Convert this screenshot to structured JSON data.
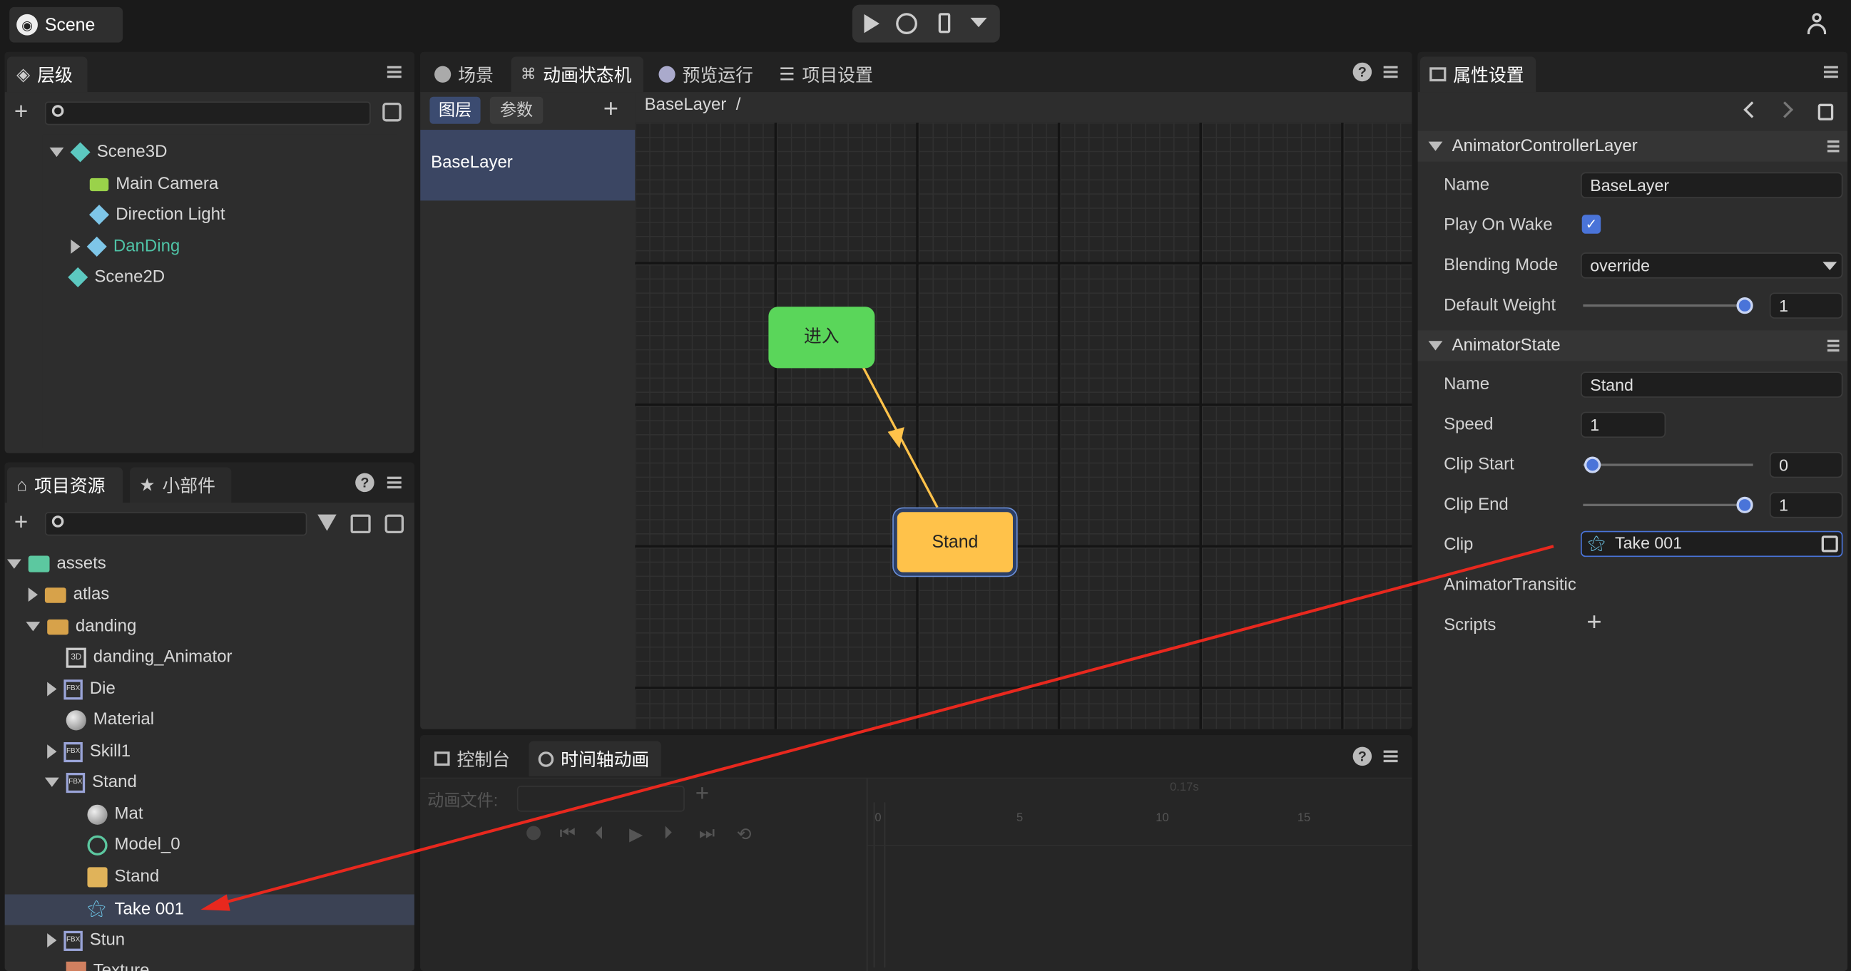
{
  "top": {
    "scene_tab": "Scene"
  },
  "hierarchy": {
    "title": "层级",
    "items": [
      {
        "label": "Scene3D",
        "color": "#d8d8d8"
      },
      {
        "label": "Main Camera",
        "color": "#d8d8d8"
      },
      {
        "label": "Direction Light",
        "color": "#d8d8d8"
      },
      {
        "label": "DanDing",
        "color": "#4fc3a6"
      },
      {
        "label": "Scene2D",
        "color": "#d8d8d8"
      }
    ]
  },
  "assets": {
    "tab1": "项目资源",
    "tab2": "小部件",
    "items": [
      "assets",
      "atlas",
      "danding",
      "danding_Animator",
      "Die",
      "Material",
      "Skill1",
      "Stand",
      "Mat",
      "Model_0",
      "Stand",
      "Take 001",
      "Stun",
      "Texture"
    ]
  },
  "center": {
    "tabs": [
      "场景",
      "动画状态机",
      "预览运行",
      "项目设置"
    ],
    "subtabs": [
      "图层",
      "参数"
    ],
    "breadcrumb": "BaseLayer  /",
    "layer_item": "BaseLayer",
    "nodes": {
      "entry": "进入",
      "stand": "Stand"
    },
    "colors": {
      "entry": "#5ad65a",
      "stand": "#ffc24a",
      "transition": "#ffc24a"
    }
  },
  "bottom": {
    "tabs": [
      "控制台",
      "时间轴动画"
    ],
    "anim_file_label": "动画文件:",
    "ruler": [
      "0",
      "5",
      "10",
      "15"
    ],
    "time": "0.17s"
  },
  "properties": {
    "title": "属性设置",
    "layer_section": "AnimatorControllerLayer",
    "layer": {
      "name_label": "Name",
      "name": "BaseLayer",
      "wake_label": "Play On Wake",
      "wake_checked": true,
      "blend_label": "Blending Mode",
      "blend": "override",
      "weight_label": "Default Weight",
      "weight": "1",
      "weight_fraction": 1.0
    },
    "state_section": "AnimatorState",
    "state": {
      "name_label": "Name",
      "name": "Stand",
      "speed_label": "Speed",
      "speed": "1",
      "clip_start_label": "Clip Start",
      "clip_start": "0",
      "clip_start_fraction": 0.0,
      "clip_end_label": "Clip End",
      "clip_end": "1",
      "clip_end_fraction": 1.0,
      "clip_label": "Clip",
      "clip": "Take 001",
      "transition_label": "AnimatorTransitic",
      "scripts_label": "Scripts"
    }
  },
  "annotation": {
    "arrow_color": "#e8281e"
  }
}
